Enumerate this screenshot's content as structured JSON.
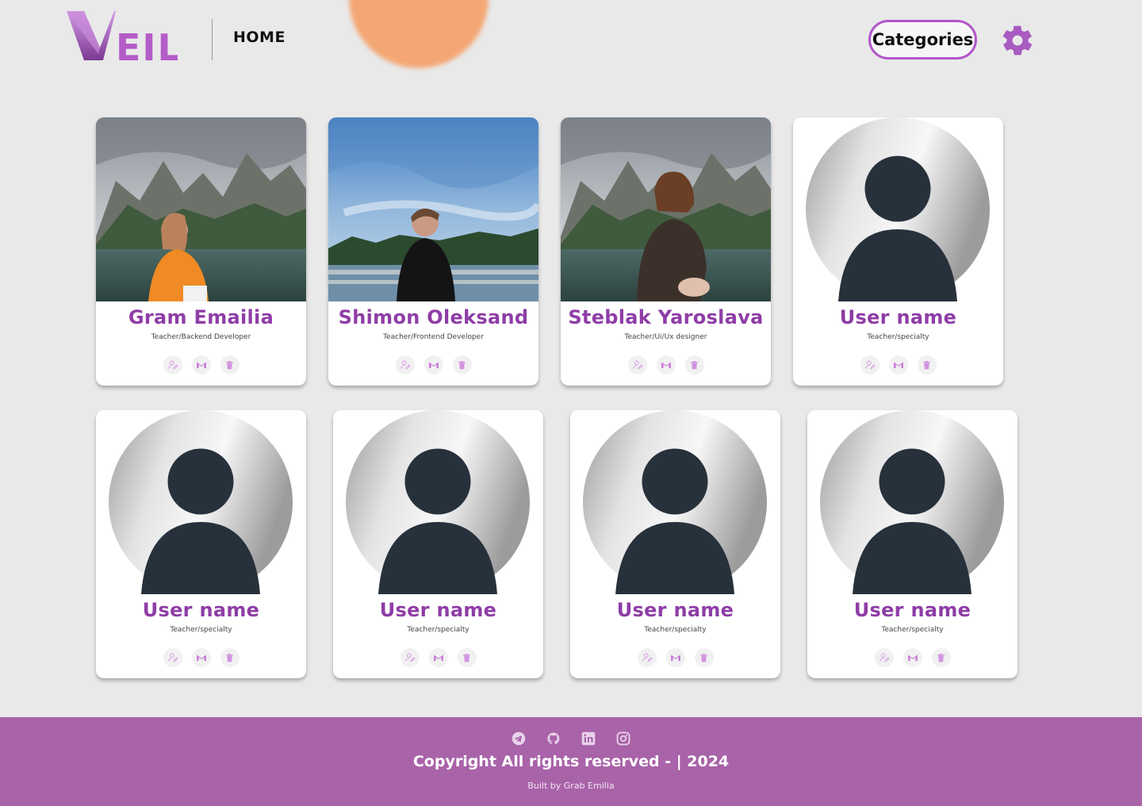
{
  "header": {
    "logo_text": "VEIL",
    "nav_home": "HOME",
    "categories_label": "Categories"
  },
  "colors": {
    "accent": "#8e3da6",
    "button_border": "#b257c8",
    "footer_bg": "#a963a9",
    "page_bg": "#e9e9e9"
  },
  "cards": [
    {
      "name": "Gram Emailia",
      "specialty": "Teacher/Backend Developer",
      "photo": "mountain-lake-photo"
    },
    {
      "name": "Shimon Oleksand",
      "specialty": "Teacher/Frontend Developer",
      "photo": "sky-lake-photo"
    },
    {
      "name": "Steblak Yaroslava",
      "specialty": "Teacher/Ui/Ux designer",
      "photo": "mountain-lake-photo"
    },
    {
      "name": "User name",
      "specialty": "Teacher/specialty",
      "photo": "default-avatar"
    },
    {
      "name": "User name",
      "specialty": "Teacher/specialty",
      "photo": "default-avatar"
    },
    {
      "name": "User name",
      "specialty": "Teacher/specialty",
      "photo": "default-avatar"
    },
    {
      "name": "User name",
      "specialty": "Teacher/specialty",
      "photo": "default-avatar"
    },
    {
      "name": "User name",
      "specialty": "Teacher/specialty",
      "photo": "default-avatar"
    }
  ],
  "card_actions": [
    "edit-user-icon",
    "gmail-icon",
    "trash-icon"
  ],
  "footer": {
    "socials": [
      "telegram-icon",
      "github-icon",
      "linkedin-icon",
      "instagram-icon"
    ],
    "copyright": "Copyright All rights reserved - | 2024",
    "built_by": "Built by Grab Emilia"
  }
}
